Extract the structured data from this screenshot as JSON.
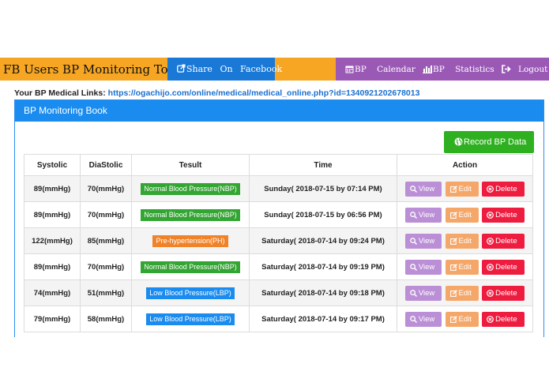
{
  "header": {
    "brand": "FB Users BP Monitoring Tools",
    "share_label": "Share On Facebook",
    "nav": [
      {
        "label": "BP Calendar",
        "icon": "calendar-icon"
      },
      {
        "label": "BP Statistics",
        "icon": "bar-chart-icon"
      },
      {
        "label": "Logout",
        "icon": "logout-icon"
      }
    ]
  },
  "links": {
    "label": "Your BP Medical Links:",
    "url": "https://ogachijo.com/online/medical/medical_online.php?id=1340921202678013"
  },
  "panel": {
    "title": "BP Monitoring Book",
    "record_label": "Record BP Data"
  },
  "table": {
    "headers": [
      "Systolic",
      "DiaStolic",
      "Tesult",
      "Time",
      "Action"
    ],
    "actions": {
      "view": "View",
      "edit": "Edit",
      "delete": "Delete"
    },
    "rows": [
      {
        "systolic": "89(mmHg)",
        "diastolic": "70(mmHg)",
        "result": "Normal Blood Pressure(NBP)",
        "type": "normal",
        "time": "Sunday( 2018-07-15 by 07:14 PM)"
      },
      {
        "systolic": "89(mmHg)",
        "diastolic": "70(mmHg)",
        "result": "Normal Blood Pressure(NBP)",
        "type": "normal",
        "time": "Sunday( 2018-07-15 by 06:56 PM)"
      },
      {
        "systolic": "122(mmHg)",
        "diastolic": "85(mmHg)",
        "result": "Pre-hypertension(PH)",
        "type": "pre",
        "time": "Saturday( 2018-07-14 by 09:24 PM)"
      },
      {
        "systolic": "89(mmHg)",
        "diastolic": "70(mmHg)",
        "result": "Normal Blood Pressure(NBP)",
        "type": "normal",
        "time": "Saturday( 2018-07-14 by 09:19 PM)"
      },
      {
        "systolic": "74(mmHg)",
        "diastolic": "51(mmHg)",
        "result": "Low Blood Pressure(LBP)",
        "type": "low",
        "time": "Saturday( 2018-07-14 by 09:18 PM)"
      },
      {
        "systolic": "79(mmHg)",
        "diastolic": "58(mmHg)",
        "result": "Low Blood Pressure(LBP)",
        "type": "low",
        "time": "Saturday( 2018-07-14 by 09:17 PM)"
      }
    ]
  },
  "colors": {
    "topbar": "#f6a623",
    "share": "#1a78d6",
    "nav": "#9b59b6",
    "panel": "#1a8cf0",
    "record": "#2fb020"
  }
}
